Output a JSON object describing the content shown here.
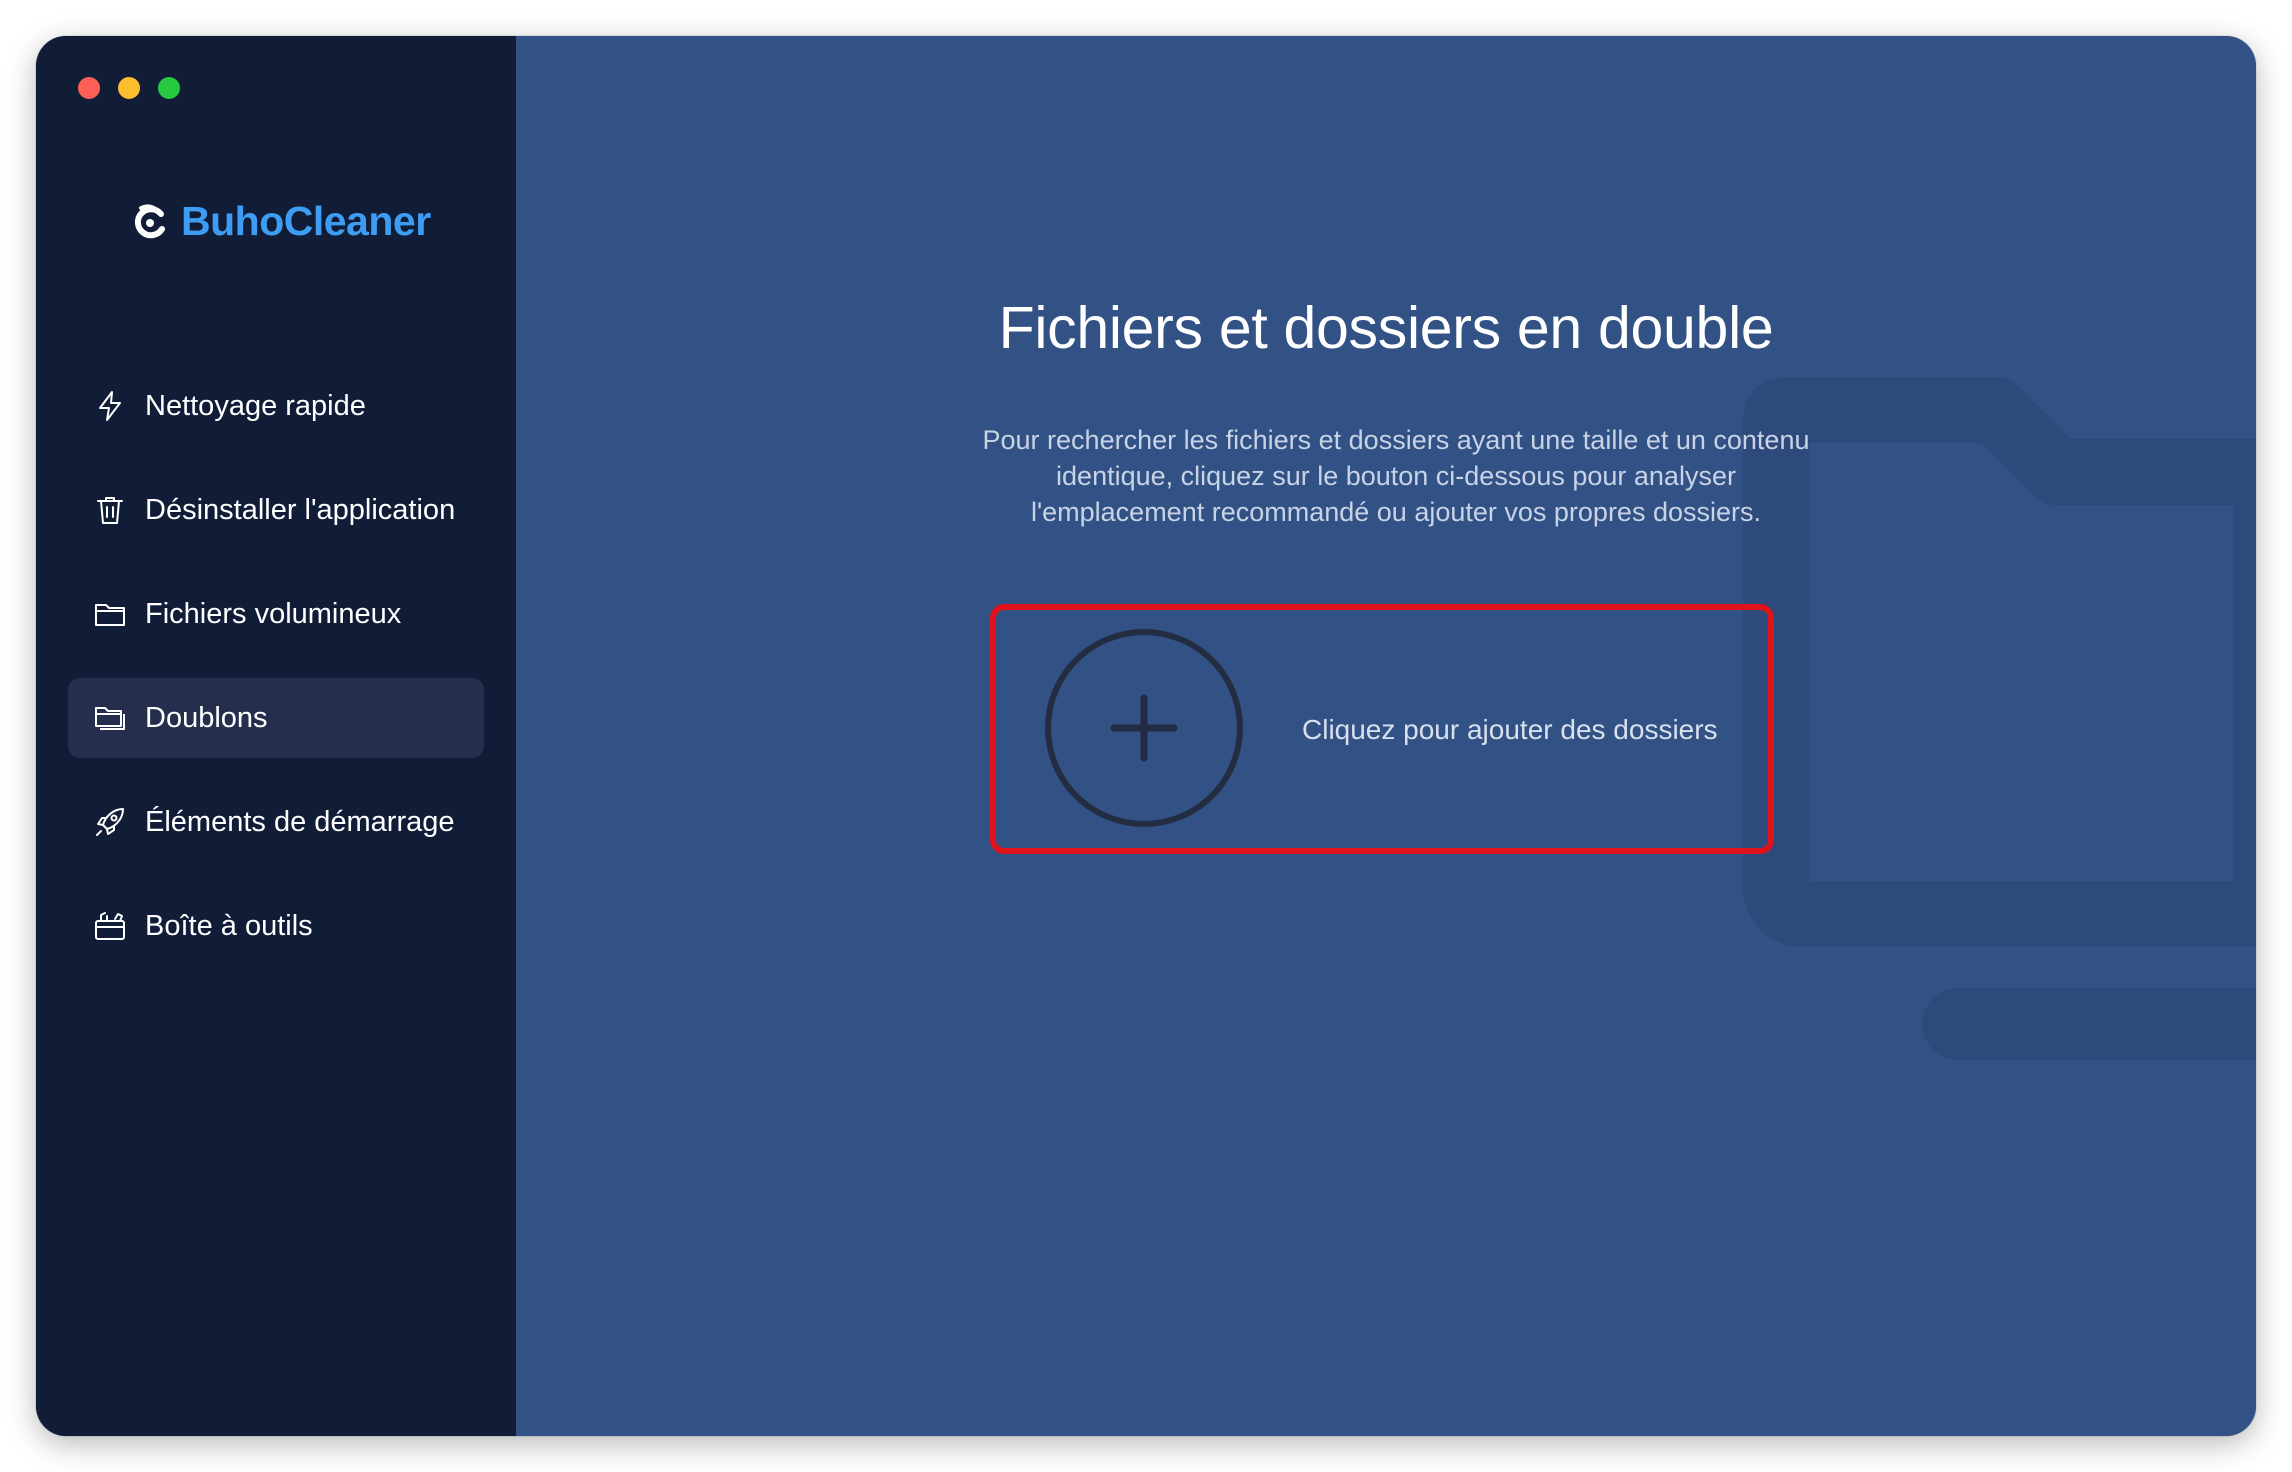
{
  "window": {
    "traffic_lights": [
      "close",
      "minimize",
      "zoom"
    ]
  },
  "brand": {
    "name": "BuhoCleaner",
    "color": "#3d9df3"
  },
  "sidebar": {
    "items": [
      {
        "label": "Nettoyage rapide",
        "icon": "lightning-icon",
        "active": false
      },
      {
        "label": "Désinstaller l'application",
        "icon": "trash-icon",
        "active": false
      },
      {
        "label": "Fichiers volumineux",
        "icon": "folder-icon",
        "active": false
      },
      {
        "label": "Doublons",
        "icon": "duplicate-folder-icon",
        "active": true
      },
      {
        "label": "Éléments de démarrage",
        "icon": "rocket-icon",
        "active": false
      },
      {
        "label": "Boîte à outils",
        "icon": "toolbox-icon",
        "active": false
      }
    ]
  },
  "main": {
    "title": "Fichiers et dossiers en double",
    "description_lines": [
      "Pour rechercher les fichiers et dossiers ayant une taille et un contenu",
      "identique, cliquez sur le bouton ci-dessous pour analyser",
      "l'emplacement recommandé ou ajouter vos propres dossiers."
    ],
    "add_button_label": "Cliquez pour ajouter des dossiers"
  },
  "colors": {
    "sidebar_bg": "#111c37",
    "main_bg": "#325185",
    "highlight_border": "#e0121c"
  }
}
